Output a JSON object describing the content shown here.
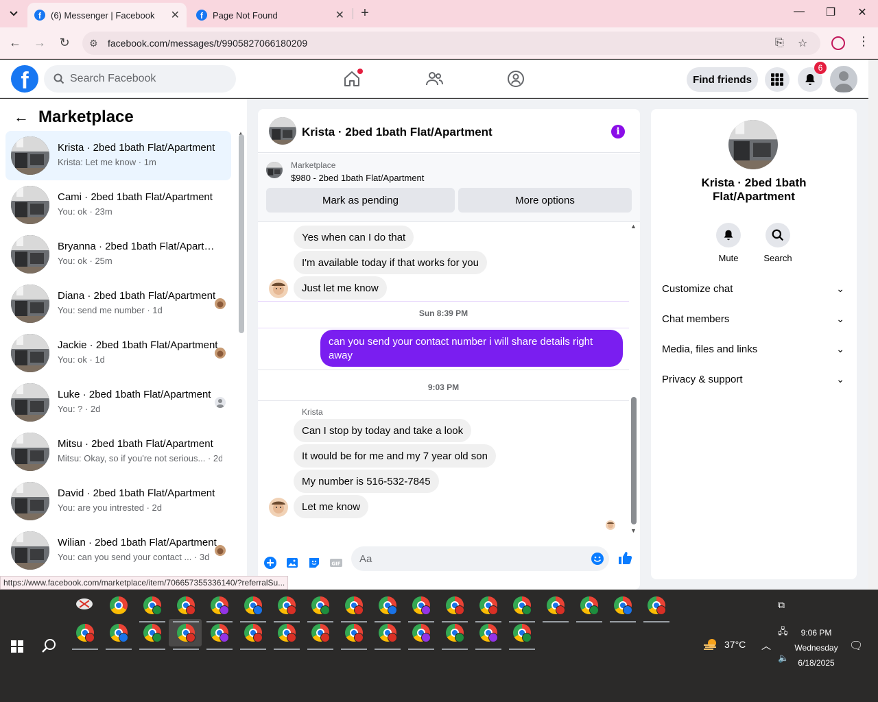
{
  "browser": {
    "tabs": [
      {
        "title": "(6) Messenger | Facebook",
        "active": true
      },
      {
        "title": "Page Not Found",
        "active": false
      }
    ],
    "url": "facebook.com/messages/t/9905827066180209",
    "status_url": "https://www.facebook.com/marketplace/item/706657355336140/?referralSu..."
  },
  "fb": {
    "search_placeholder": "Search Facebook",
    "find_friends": "Find friends",
    "notifications_count": "6"
  },
  "sidebar": {
    "title": "Marketplace",
    "conversations": [
      {
        "name": "Krista · 2bed 1bath Flat/Apartment",
        "snippet": "Krista: Let me know · 1m",
        "active": true
      },
      {
        "name": "Cami · 2bed 1bath Flat/Apartment",
        "snippet": "You: ok · 23m"
      },
      {
        "name": "Bryanna · 2bed 1bath Flat/Apartment",
        "snippet": "You: ok · 25m"
      },
      {
        "name": "Diana · 2bed 1bath Flat/Apartment",
        "snippet": "You: send me number · 1d"
      },
      {
        "name": "Jackie · 2bed 1bath Flat/Apartment",
        "snippet": "You: ok · 1d"
      },
      {
        "name": "Luke · 2bed 1bath Flat/Apartment",
        "snippet": "You: ? · 2d"
      },
      {
        "name": "Mitsu · 2bed 1bath Flat/Apartment",
        "snippet": "Mitsu: Okay, so if you're not serious... · 2d"
      },
      {
        "name": "David · 2bed 1bath Flat/Apartment",
        "snippet": "You: are you intrested · 2d"
      },
      {
        "name": "Wilian · 2bed 1bath Flat/Apartment",
        "snippet": "You: can you send your contact ... · 3d"
      }
    ]
  },
  "chat": {
    "title": "Krista · 2bed 1bath Flat/Apartment",
    "marketplace_label": "Marketplace",
    "listing": "$980 - 2bed 1bath Flat/Apartment",
    "mark_pending": "Mark as pending",
    "more_options": "More options",
    "messages_earlier": [
      "Yes when can I do that",
      "I'm available today if that works for you",
      "Just let me know"
    ],
    "stamp1": "Sun 8:39 PM",
    "outgoing": "can you send your contact number i will share details right away",
    "stamp2": "9:03 PM",
    "sender_name": "Krista",
    "messages_later": [
      "Can I stop by today and take a look",
      "It would be for me and my 7 year old son",
      "My number is 516-532-7845",
      "Let me know"
    ],
    "composer_placeholder": "Aa"
  },
  "details": {
    "name": "Krista · 2bed 1bath Flat/Apartment",
    "mute": "Mute",
    "search": "Search",
    "sections": [
      "Customize chat",
      "Chat members",
      "Media, files and links",
      "Privacy & support"
    ]
  },
  "taskbar": {
    "temperature": "37°C",
    "time": "9:06 PM",
    "day": "Wednesday",
    "date": "6/18/2025"
  }
}
